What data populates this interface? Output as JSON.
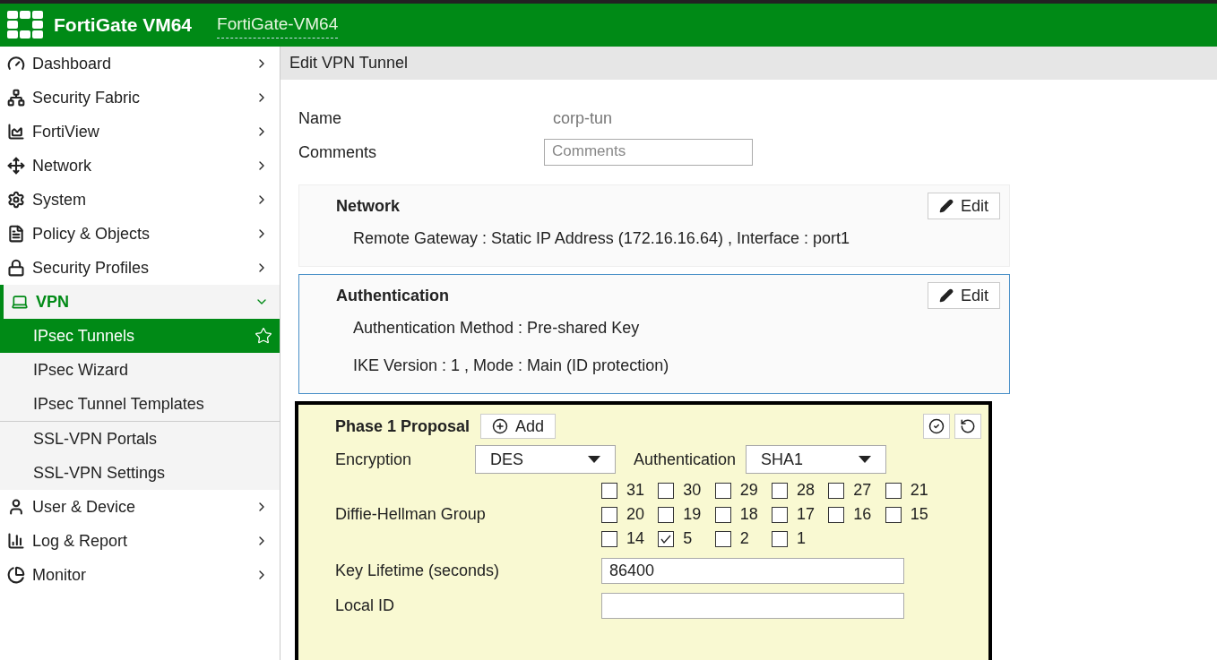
{
  "header": {
    "product": "FortiGate VM64",
    "hostname": "FortiGate-VM64"
  },
  "sidebar": {
    "items": [
      {
        "label": "Dashboard",
        "expanded": false
      },
      {
        "label": "Security Fabric",
        "expanded": false
      },
      {
        "label": "FortiView",
        "expanded": false
      },
      {
        "label": "Network",
        "expanded": false
      },
      {
        "label": "System",
        "expanded": false
      },
      {
        "label": "Policy & Objects",
        "expanded": false
      },
      {
        "label": "Security Profiles",
        "expanded": false
      },
      {
        "label": "VPN",
        "expanded": true,
        "groups": [
          {
            "children": [
              {
                "label": "IPsec Tunnels",
                "selected": true
              },
              {
                "label": "IPsec Wizard",
                "selected": false
              },
              {
                "label": "IPsec Tunnel Templates",
                "selected": false
              }
            ]
          },
          {
            "children": [
              {
                "label": "SSL-VPN Portals",
                "selected": false
              },
              {
                "label": "SSL-VPN Settings",
                "selected": false
              }
            ]
          }
        ]
      },
      {
        "label": "User & Device",
        "expanded": false
      },
      {
        "label": "Log & Report",
        "expanded": false
      },
      {
        "label": "Monitor",
        "expanded": false
      }
    ]
  },
  "page_title": "Edit VPN Tunnel",
  "name": {
    "label": "Name",
    "value": "corp-tun"
  },
  "comments": {
    "label": "Comments",
    "placeholder": "Comments"
  },
  "sections": [
    {
      "title": "Network",
      "button": "Edit",
      "focused": false,
      "lines": [
        "Remote Gateway : Static IP Address (172.16.16.64) , Interface : port1"
      ]
    },
    {
      "title": "Authentication",
      "button": "Edit",
      "focused": true,
      "lines": [
        "Authentication Method : Pre-shared Key",
        "IKE Version : 1 , Mode : Main (ID protection)"
      ]
    }
  ],
  "phase1": {
    "title": "Phase 1 Proposal",
    "add_button": "Add",
    "encryption": {
      "label": "Encryption",
      "value": "DES"
    },
    "authentication": {
      "label": "Authentication",
      "value": "SHA1"
    },
    "dh_group": {
      "label": "Diffie-Hellman Group",
      "options": [
        {
          "label": "31",
          "checked": false
        },
        {
          "label": "30",
          "checked": false
        },
        {
          "label": "29",
          "checked": false
        },
        {
          "label": "28",
          "checked": false
        },
        {
          "label": "27",
          "checked": false
        },
        {
          "label": "21",
          "checked": false
        },
        {
          "label": "20",
          "checked": false
        },
        {
          "label": "19",
          "checked": false
        },
        {
          "label": "18",
          "checked": false
        },
        {
          "label": "17",
          "checked": false
        },
        {
          "label": "16",
          "checked": false
        },
        {
          "label": "15",
          "checked": false
        },
        {
          "label": "14",
          "checked": false
        },
        {
          "label": "5",
          "checked": true
        },
        {
          "label": "2",
          "checked": false
        },
        {
          "label": "1",
          "checked": false
        }
      ]
    },
    "key_lifetime": {
      "label": "Key Lifetime (seconds)",
      "value": "86400"
    },
    "local_id": {
      "label": "Local ID"
    }
  }
}
